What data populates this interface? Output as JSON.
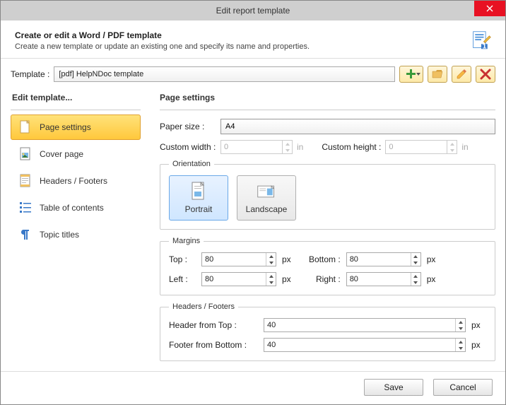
{
  "window": {
    "title": "Edit report template"
  },
  "header": {
    "title": "Create or edit a Word / PDF template",
    "subtitle": "Create a new template or update an existing one and specify its name and properties."
  },
  "template": {
    "label": "Template :",
    "value": "[pdf] HelpNDoc template"
  },
  "sidebar": {
    "title": "Edit template...",
    "items": [
      {
        "label": "Page settings"
      },
      {
        "label": "Cover page"
      },
      {
        "label": "Headers / Footers"
      },
      {
        "label": "Table of contents"
      },
      {
        "label": "Topic titles"
      }
    ]
  },
  "page_settings": {
    "title": "Page settings",
    "paper_size_label": "Paper size :",
    "paper_size": "A4",
    "custom_width_label": "Custom width :",
    "custom_width": "0",
    "custom_height_label": "Custom height :",
    "custom_height": "0",
    "unit_in": "in",
    "unit_px": "px",
    "orientation": {
      "legend": "Orientation",
      "portrait": "Portrait",
      "landscape": "Landscape"
    },
    "margins": {
      "legend": "Margins",
      "top_label": "Top :",
      "top": "80",
      "bottom_label": "Bottom :",
      "bottom": "80",
      "left_label": "Left :",
      "left": "80",
      "right_label": "Right :",
      "right": "80"
    },
    "hf": {
      "legend": "Headers / Footers",
      "header_label": "Header from Top :",
      "header": "40",
      "footer_label": "Footer from Bottom :",
      "footer": "40"
    }
  },
  "footer": {
    "save": "Save",
    "cancel": "Cancel"
  }
}
